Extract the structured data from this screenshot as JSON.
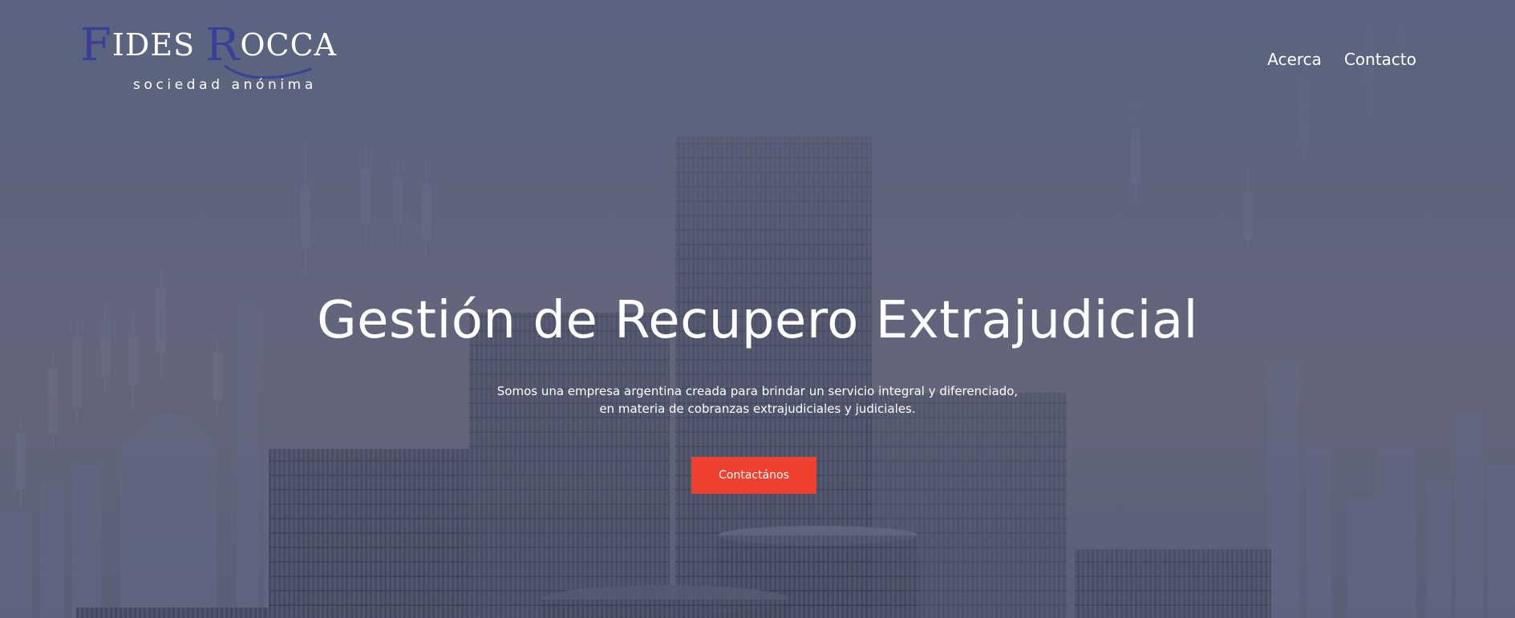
{
  "header": {
    "logo": {
      "main_cap1": "F",
      "main_rest1": "IDES ",
      "main_cap2": "R",
      "main_rest2": "OCCA",
      "subtitle": "sociedad anónima"
    },
    "nav": [
      {
        "label": "Acerca"
      },
      {
        "label": "Contacto"
      }
    ]
  },
  "hero": {
    "title": "Gestión de Recupero Extrajudicial",
    "description_line1": "Somos una empresa argentina creada para brindar un servicio integral y diferenciado,",
    "description_line2": "en materia de cobranzas extrajudiciales y judiciales.",
    "cta_label": "Contactános"
  },
  "colors": {
    "accent": "#f0402f",
    "logo_cap": "#3a3f9a",
    "text": "#ffffff"
  },
  "icons": {
    "background": "coins-stacks-financial-chart-image"
  }
}
